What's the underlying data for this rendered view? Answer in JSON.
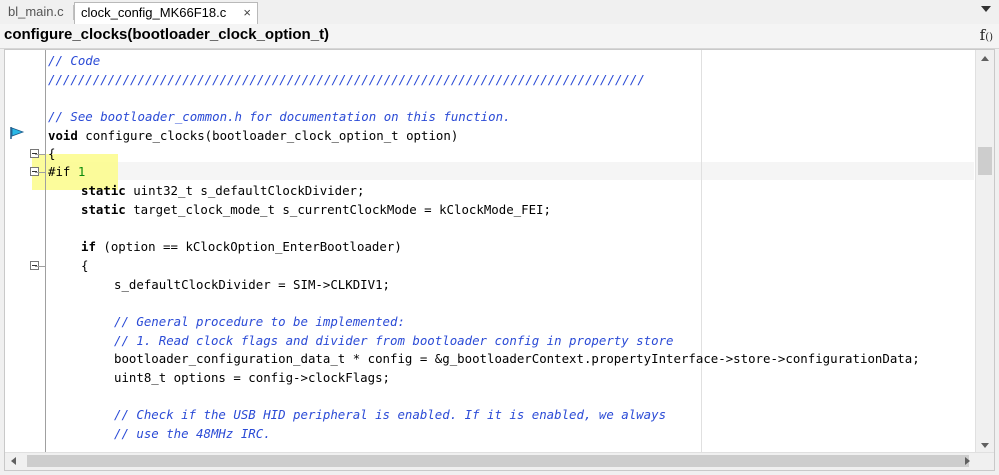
{
  "tabs": [
    {
      "label": "bl_main.c",
      "active": false
    },
    {
      "label": "clock_config_MK66F18.c",
      "active": true,
      "close": "×"
    }
  ],
  "function_bar": {
    "name": "configure_clocks(bootloader_clock_option_t)",
    "fx_icon_main": "f",
    "fx_icon_sub": "()"
  },
  "code_lines": {
    "l1": "// Code",
    "l2": "////////////////////////////////////////////////////////////////////////////////",
    "l3": "// See bootloader_common.h for documentation on this function.",
    "l4_kw": "void",
    "l4_rest": " configure_clocks(bootloader_clock_option_t option)",
    "l5": "{",
    "l6_dir": "#if ",
    "l6_num": "1",
    "l7_kw": "static",
    "l7_rest": " uint32_t s_defaultClockDivider;",
    "l8_kw": "static",
    "l8_rest": " target_clock_mode_t s_currentClockMode = kClockMode_FEI;",
    "l9_kw": "if",
    "l9_rest": " (option == kClockOption_EnterBootloader)",
    "l10": "{",
    "l11": "s_defaultClockDivider = SIM->CLKDIV1;",
    "l12": "// General procedure to be implemented:",
    "l13": "// 1. Read clock flags and divider from bootloader config in property store",
    "l14": "bootloader_configuration_data_t * config = &g_bootloaderContext.propertyInterface->store->configurationData;",
    "l15": "uint8_t options = config->clockFlags;",
    "l16": "// Check if the USB HID peripheral is enabled. If it is enabled, we always",
    "l17": "// use the 48MHz IRC."
  },
  "colors": {
    "comment": "#2b4bd6",
    "number": "#0a8a0a",
    "highlight": "#fbfb8a"
  },
  "icons": {
    "bookmark": "arrow-flag-icon",
    "dropdown": "chevron-down-icon",
    "function_list": "function-icon"
  }
}
